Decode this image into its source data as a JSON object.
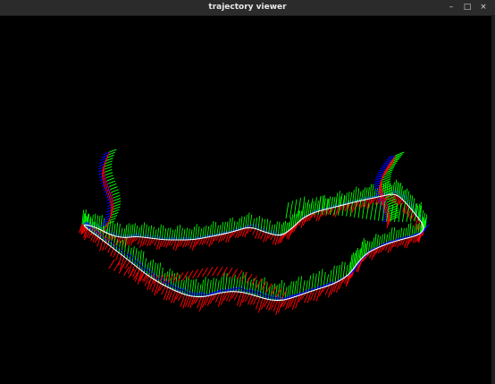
{
  "window": {
    "title": "trajectory viewer",
    "controls": {
      "minimize": "–",
      "maximize": "□",
      "close": "×"
    },
    "icons": {
      "minimize": "minimize-icon",
      "maximize": "maximize-icon",
      "close": "close-icon"
    }
  },
  "colors": {
    "background": "#000000",
    "axis_x": "#ff0000",
    "axis_y": "#00ff00",
    "axis_z": "#0000ff",
    "trajectory": "#ffffff"
  }
}
